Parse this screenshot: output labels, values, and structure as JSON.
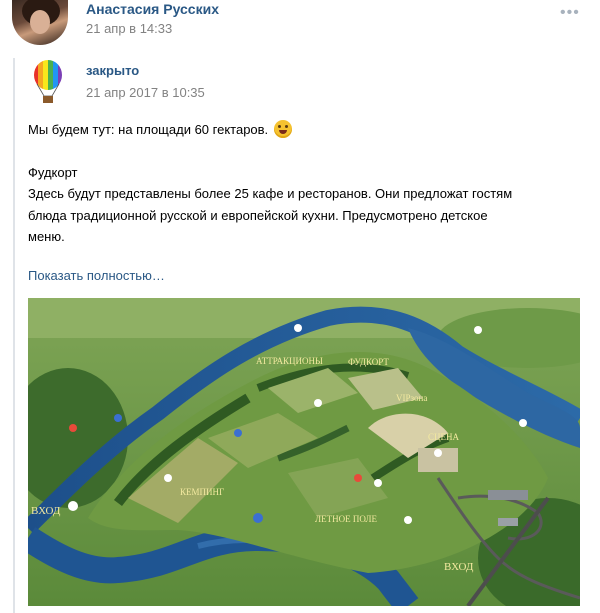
{
  "post": {
    "author_name": "Анастасия Русских",
    "timestamp": "21 апр в 14:33",
    "more_icon": "ellipsis-icon"
  },
  "repost": {
    "group_name": "закрыто",
    "timestamp": "21 апр 2017 в 10:35",
    "avatar_icon": "hot-air-balloon-icon",
    "text_line1": "Мы будем тут: на площади 60 гектаров.",
    "emoji": "laughing-emoji",
    "heading": "Фудкорт",
    "body_line1": "Здесь будут представлены более 25 кафе и ресторанов. Они предложат гостям",
    "body_line2": "блюда традиционной русской и европейской кухни. Предусмотрено детское",
    "body_line3": "меню.",
    "show_more": "Показать полностью…"
  },
  "map": {
    "labels": {
      "attractions": "АТТРАКЦИОНЫ",
      "foodcourt": "ФУДКОРТ",
      "vip": "VIPзона",
      "stage": "СЦЕНА",
      "camping": "КЕМПИНГ",
      "summer_field": "ЛЕТНОЕ ПОЛЕ",
      "entrance_left": "ВХОД",
      "entrance_right": "ВХОД"
    }
  },
  "colors": {
    "link": "#2a5885",
    "secondary": "#828282",
    "quote_line": "#dfe3e8"
  }
}
